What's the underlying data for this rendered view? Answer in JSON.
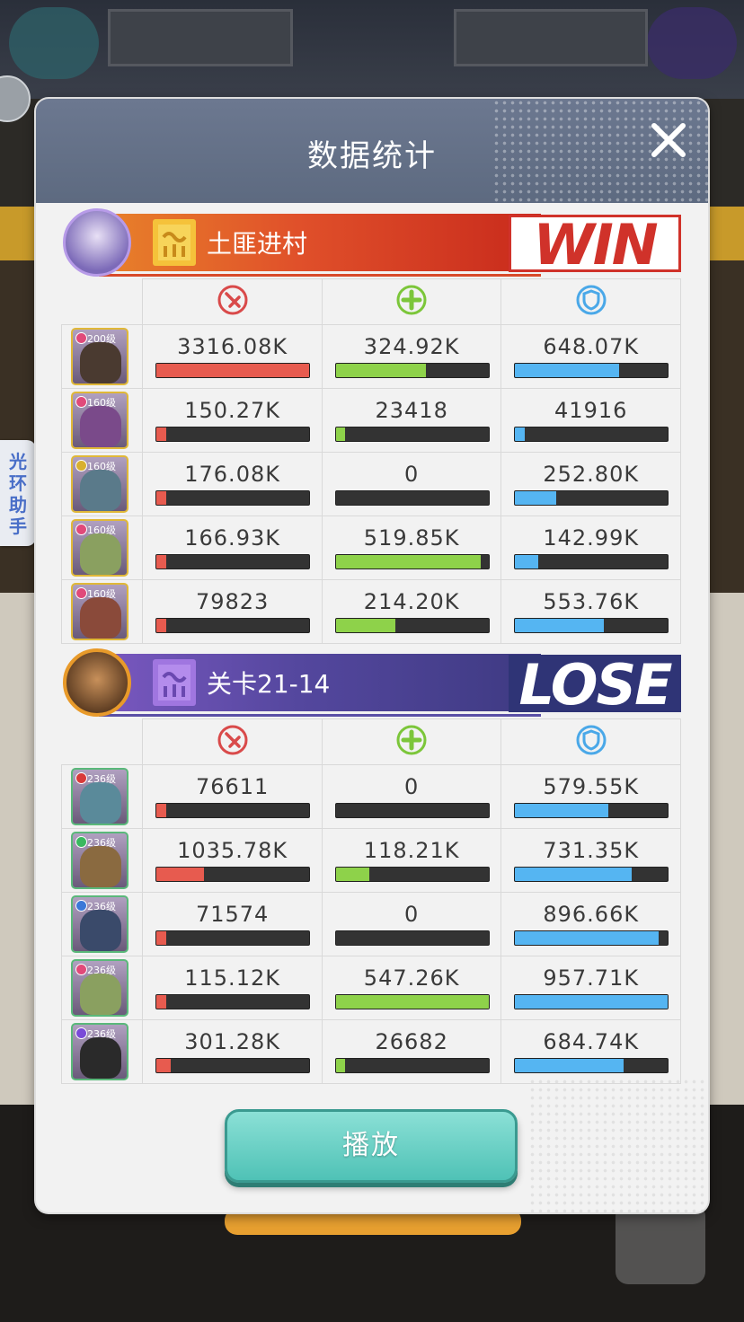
{
  "dialog": {
    "title": "数据统计",
    "play_button": "播放"
  },
  "side_tab": {
    "label": "光环助手"
  },
  "stat_icons": [
    "attack-icon",
    "heal-icon",
    "shield-icon"
  ],
  "colors": {
    "damage_bar": "#e75b4f",
    "heal_bar": "#8ed24a",
    "defense_bar": "#55b5f2",
    "win": "#d0322a",
    "lose": "#2f3476",
    "play_button": "#4fc2b6"
  },
  "teams": [
    {
      "name": "土匪进村",
      "result": "WIN",
      "heroes": [
        {
          "level": "200级",
          "damage": "3316.08K",
          "heal": "324.92K",
          "defense": "648.07K",
          "damage_fill": 1.0,
          "heal_fill": 0.59,
          "defense_fill": 0.68
        },
        {
          "level": "160级",
          "damage": "150.27K",
          "heal": "23418",
          "defense": "41916",
          "damage_fill": 0.05,
          "heal_fill": 0.05,
          "defense_fill": 0.05
        },
        {
          "level": "160级",
          "damage": "176.08K",
          "heal": "0",
          "defense": "252.80K",
          "damage_fill": 0.05,
          "heal_fill": 0.0,
          "defense_fill": 0.27
        },
        {
          "level": "160级",
          "damage": "166.93K",
          "heal": "519.85K",
          "defense": "142.99K",
          "damage_fill": 0.05,
          "heal_fill": 0.95,
          "defense_fill": 0.15
        },
        {
          "level": "160级",
          "damage": "79823",
          "heal": "214.20K",
          "defense": "553.76K",
          "damage_fill": 0.02,
          "heal_fill": 0.39,
          "defense_fill": 0.58
        }
      ]
    },
    {
      "name": "关卡21-14",
      "result": "LOSE",
      "heroes": [
        {
          "level": "236级",
          "damage": "76611",
          "heal": "0",
          "defense": "579.55K",
          "damage_fill": 0.02,
          "heal_fill": 0.0,
          "defense_fill": 0.61
        },
        {
          "level": "236级",
          "damage": "1035.78K",
          "heal": "118.21K",
          "defense": "731.35K",
          "damage_fill": 0.31,
          "heal_fill": 0.22,
          "defense_fill": 0.76
        },
        {
          "level": "236级",
          "damage": "71574",
          "heal": "0",
          "defense": "896.66K",
          "damage_fill": 0.02,
          "heal_fill": 0.0,
          "defense_fill": 0.94
        },
        {
          "level": "236级",
          "damage": "115.12K",
          "heal": "547.26K",
          "defense": "957.71K",
          "damage_fill": 0.03,
          "heal_fill": 1.0,
          "defense_fill": 1.0
        },
        {
          "level": "236级",
          "damage": "301.28K",
          "heal": "26682",
          "defense": "684.74K",
          "damage_fill": 0.09,
          "heal_fill": 0.05,
          "defense_fill": 0.71
        }
      ]
    }
  ]
}
